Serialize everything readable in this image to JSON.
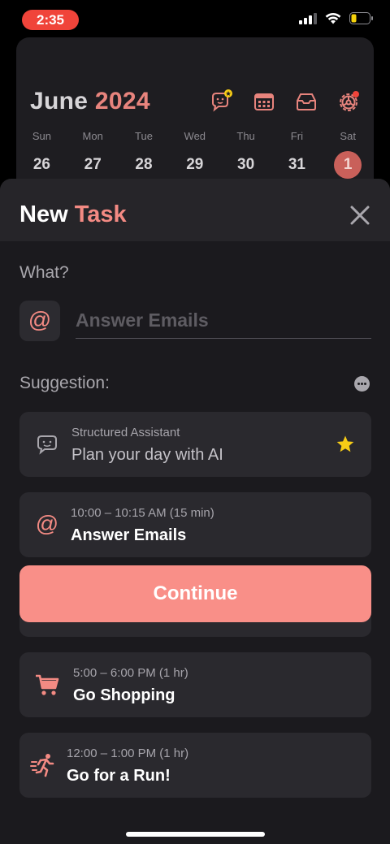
{
  "status_bar": {
    "time": "2:35"
  },
  "calendar": {
    "month": "June",
    "year": "2024",
    "weekdays": [
      "Sun",
      "Mon",
      "Tue",
      "Wed",
      "Thu",
      "Fri",
      "Sat"
    ],
    "dates": [
      "26",
      "27",
      "28",
      "29",
      "30",
      "31",
      "1"
    ],
    "selected_date": "1"
  },
  "sheet": {
    "title_first": "New",
    "title_accent": "Task",
    "what_label": "What?",
    "task_placeholder": "Answer Emails",
    "at_symbol": "@",
    "suggestion_label": "Suggestion:",
    "suggestions": [
      {
        "subtitle": "Structured Assistant",
        "title": "Plan your day with AI",
        "icon": "assistant-chat-icon"
      },
      {
        "subtitle": "10:00 – 10:15 AM (15 min)",
        "title": "Answer Emails",
        "icon": "at-icon"
      },
      {
        "subtitle": "5:00 – 6:00 PM (1 hr)",
        "title": "Go Shopping",
        "icon": "shopping-cart-icon"
      },
      {
        "subtitle": "12:00 – 1:00 PM (1 hr)",
        "title": "Go for a Run!",
        "icon": "running-icon"
      }
    ],
    "continue_label": "Continue"
  },
  "colors": {
    "accent": "#f38a83",
    "button": "#f98f88",
    "sheet_bg": "#1b1a1e",
    "card_bg": "#2a292e",
    "star": "#f7cc16"
  }
}
